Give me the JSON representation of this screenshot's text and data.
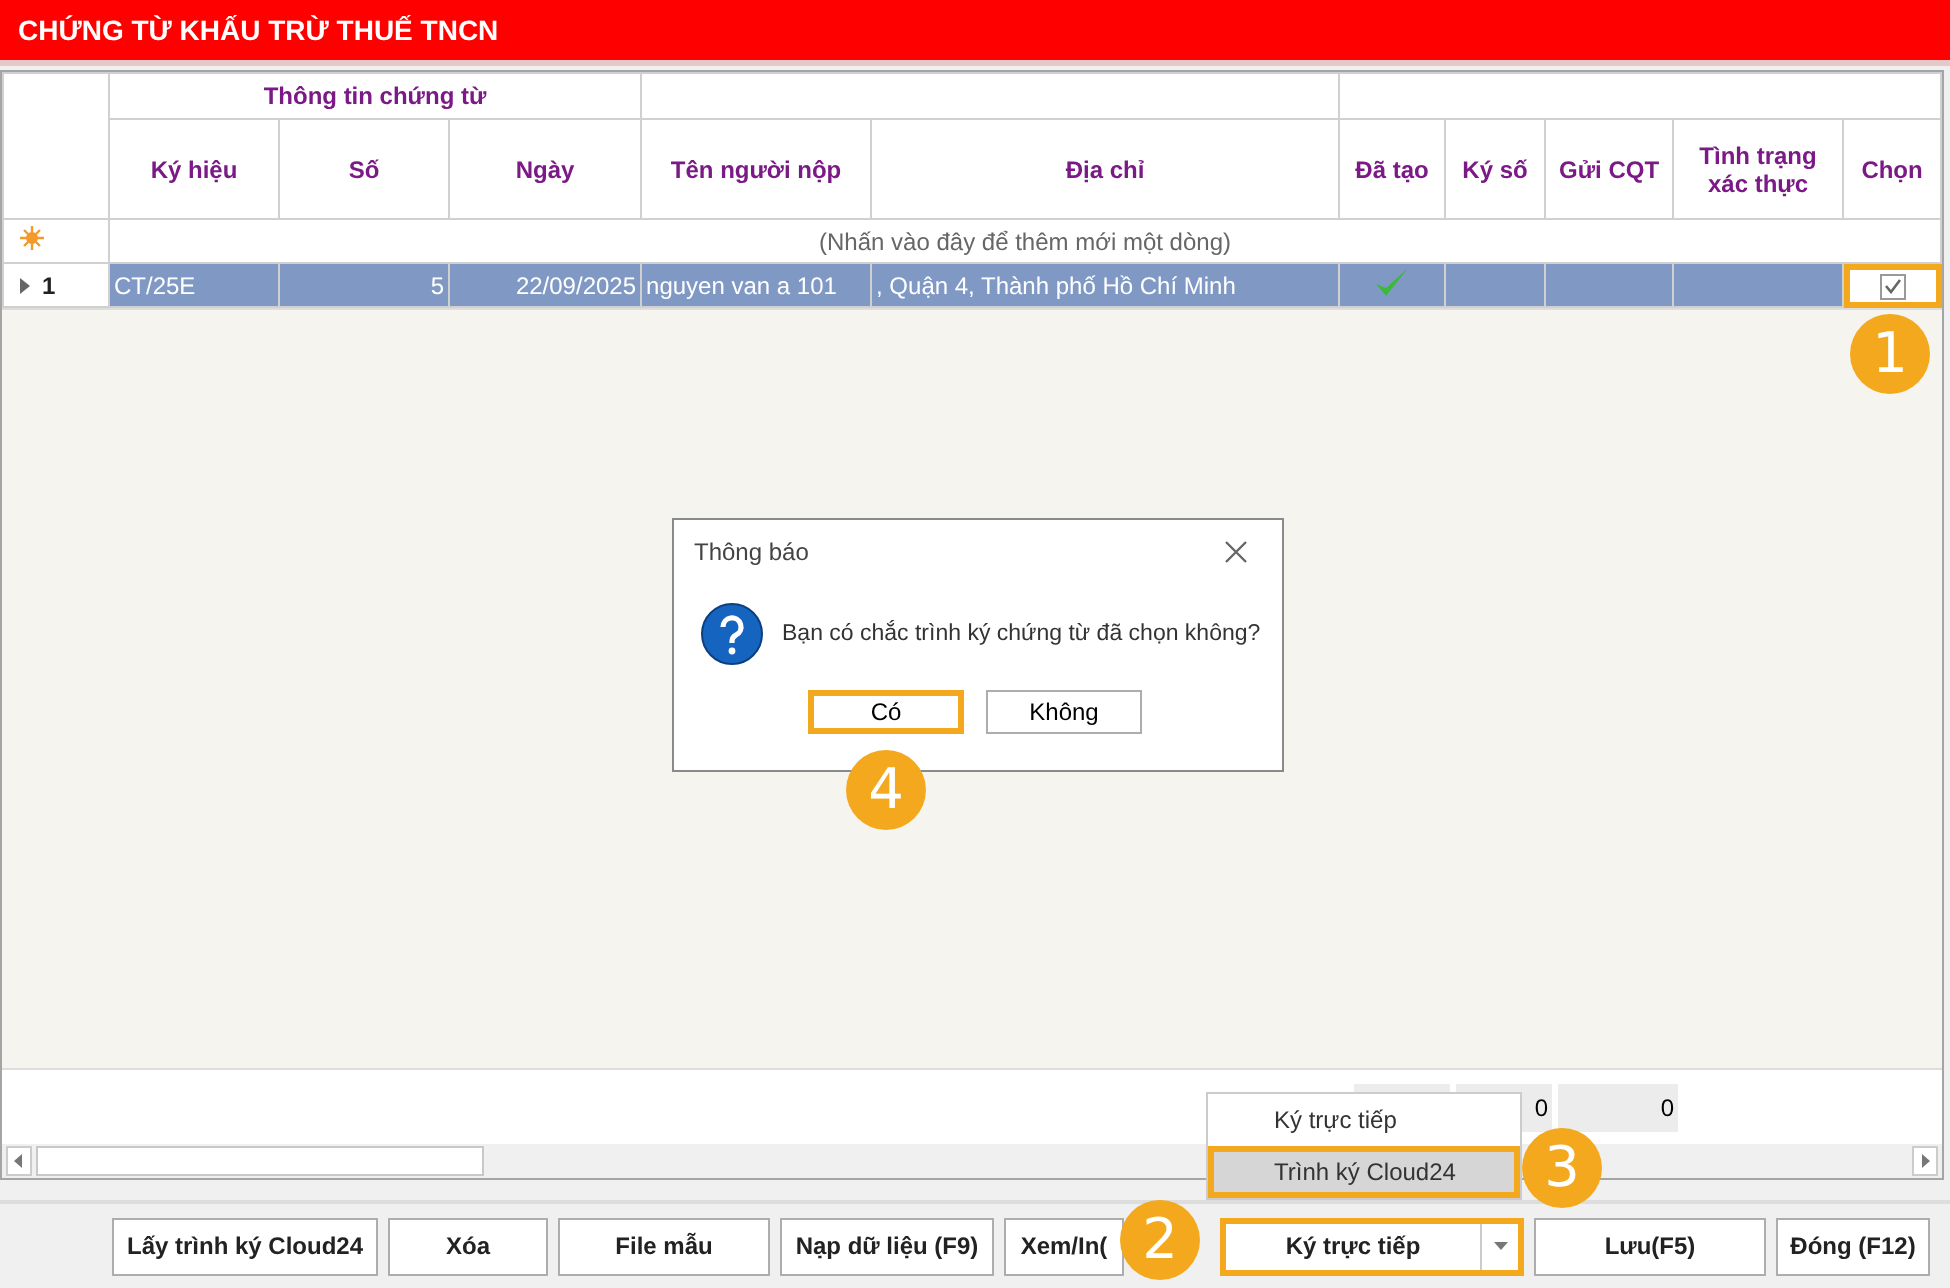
{
  "title": "CHỨNG TỪ KHẤU TRỪ THUẾ TNCN",
  "grid": {
    "group_header": "Thông tin chứng từ",
    "columns": [
      "Ký hiệu",
      "Số",
      "Ngày",
      "Tên người nộp",
      "Địa chỉ",
      "Đã tạo",
      "Ký số",
      "Gửi CQT",
      "Tình trạng xác thực",
      "Chọn"
    ],
    "new_row_hint": "(Nhấn vào đây để thêm mới một dòng)",
    "rows": [
      {
        "number": "1",
        "selected": true,
        "cells": [
          "CT/25E",
          "5",
          "22/09/2025",
          "nguyen van a 101",
          ", Quận 4, Thành phố Hồ Chí Minh"
        ],
        "created": true,
        "checked": true,
        "highlighted": true
      }
    ],
    "summary": [
      "0",
      "0"
    ]
  },
  "dialog": {
    "title": "Thông báo",
    "message": "Bạn có chắc trình ký chứng từ đã chọn không?",
    "buttons": [
      {
        "label": "Có",
        "highlighted": true
      },
      {
        "label": "Không",
        "highlighted": false
      }
    ]
  },
  "dropdown": {
    "items": [
      {
        "label": "Ký trực tiếp",
        "selected": false,
        "highlighted": false
      },
      {
        "label": "Trình ký Cloud24",
        "selected": true,
        "highlighted": true
      }
    ]
  },
  "buttons": [
    {
      "label": "Lấy trình ký Cloud24",
      "kind": "button",
      "highlighted": false
    },
    {
      "label": "Xóa",
      "kind": "button",
      "highlighted": false
    },
    {
      "label": "File mẫu",
      "kind": "button",
      "highlighted": false
    },
    {
      "label": "Nạp dữ liệu (F9)",
      "kind": "button",
      "highlighted": false
    },
    {
      "label": "Xem/In(",
      "kind": "button",
      "highlighted": false
    },
    {
      "label": "Ký trực tiếp",
      "kind": "split",
      "highlighted": true
    },
    {
      "label": "Lưu(F5)",
      "kind": "button",
      "highlighted": false
    },
    {
      "label": "Đóng (F12)",
      "kind": "button",
      "highlighted": false
    }
  ],
  "callouts": [
    "1",
    "2",
    "3",
    "4"
  ]
}
